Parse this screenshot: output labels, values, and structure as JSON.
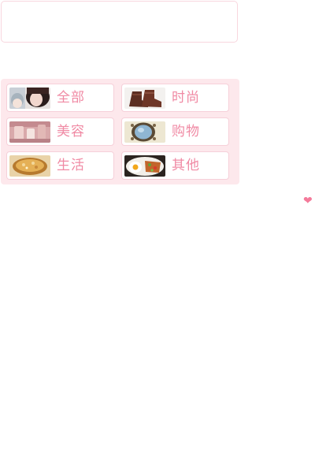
{
  "categories": [
    {
      "label": "全部",
      "thumb": "portrait-photo"
    },
    {
      "label": "时尚",
      "thumb": "boots-photo"
    },
    {
      "label": "美容",
      "thumb": "cosmetics-photo"
    },
    {
      "label": "购物",
      "thumb": "mirror-photo"
    },
    {
      "label": "生活",
      "thumb": "food-bowl-photo"
    },
    {
      "label": "其他",
      "thumb": "breakfast-plate-photo"
    }
  ],
  "colors": {
    "accent_pink": "#f08aa4",
    "panel_background": "#fde8ec",
    "heart": "#f47a9a"
  },
  "floating_icon": "heart-icon"
}
